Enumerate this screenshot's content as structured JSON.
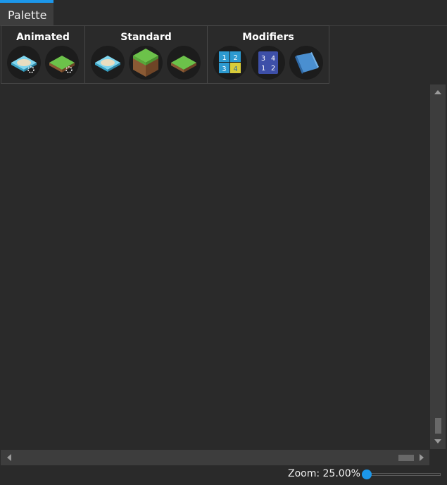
{
  "tab": {
    "label": "Palette",
    "accent_color": "#1c97ea"
  },
  "groups": [
    {
      "title": "Animated",
      "items": [
        "animated-water-tile-icon",
        "animated-grass-tile-icon"
      ]
    },
    {
      "title": "Standard",
      "items": [
        "water-tile-icon",
        "grass-block-icon",
        "flat-grass-tile-icon"
      ]
    },
    {
      "title": "Modifiers",
      "items": [
        "number-order-modifier-icon",
        "number-swap-modifier-icon",
        "slope-modifier-icon"
      ]
    }
  ],
  "status": {
    "zoom_label": "Zoom: 25.00%",
    "zoom_percent": 25.0,
    "slider_fraction": 0.0
  }
}
